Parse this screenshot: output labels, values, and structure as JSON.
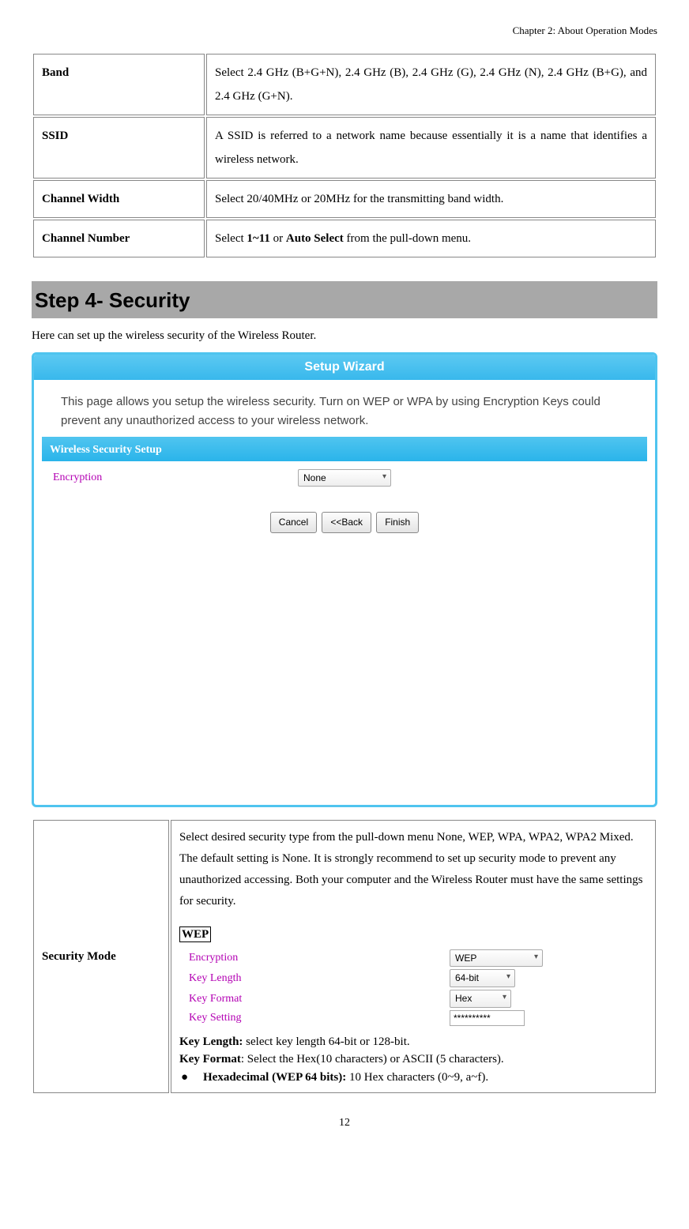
{
  "chapterHeader": "Chapter 2: About Operation Modes",
  "defTable": [
    {
      "label": "Band",
      "desc": "Select 2.4 GHz (B+G+N), 2.4 GHz (B), 2.4 GHz (G), 2.4 GHz (N), 2.4 GHz (B+G), and 2.4 GHz (G+N)."
    },
    {
      "label": "SSID",
      "desc": "A SSID is referred to a network name because essentially it is a name that identifies a wireless network."
    },
    {
      "label": "Channel Width",
      "desc": "Select 20/40MHz or 20MHz for the transmitting band width."
    }
  ],
  "channelNumber": {
    "label": "Channel Number",
    "pre": "Select ",
    "b1": "1~11",
    "mid": " or ",
    "b2": "Auto Select",
    "post": " from the pull-down menu."
  },
  "stepHeading": "Step 4- Security",
  "introText": "Here can set up the wireless security of the Wireless Router.",
  "wizard": {
    "title": "Setup Wizard",
    "desc": "This page allows you setup the wireless security. Turn on WEP or WPA by using Encryption Keys could prevent any unauthorized access to your wireless network.",
    "section": "Wireless Security Setup",
    "encryptionLabel": "Encryption",
    "encryptionValue": "None",
    "buttons": {
      "cancel": "Cancel",
      "back": "<<Back",
      "finish": "Finish"
    }
  },
  "securityMode": {
    "label": "Security Mode",
    "desc": "Select desired security type from the pull-down menu None, WEP, WPA, WPA2, WPA2 Mixed. The default setting is None. It is strongly recommend to set up security mode to prevent any unauthorized accessing. Both your computer and the Wireless Router must have the same settings for security.",
    "wepLabel": "WEP",
    "wepForm": {
      "encryption": {
        "label": "Encryption",
        "value": "WEP"
      },
      "keyLength": {
        "label": "Key Length",
        "value": "64-bit"
      },
      "keyFormat": {
        "label": "Key Format",
        "value": "Hex"
      },
      "keySetting": {
        "label": "Key Setting",
        "value": "**********"
      }
    },
    "keyLengthNote": {
      "b": "Key Length:",
      "t": " select key length 64-bit or 128-bit."
    },
    "keyFormatNote": {
      "b": "Key Format",
      "t": ": Select the Hex(10 characters) or ASCII (5 characters)."
    },
    "hexNote": {
      "bullet": "●",
      "b": "Hexadecimal (WEP 64 bits):",
      "t": " 10 Hex characters (0~9, a~f)."
    }
  },
  "pageNumber": "12"
}
